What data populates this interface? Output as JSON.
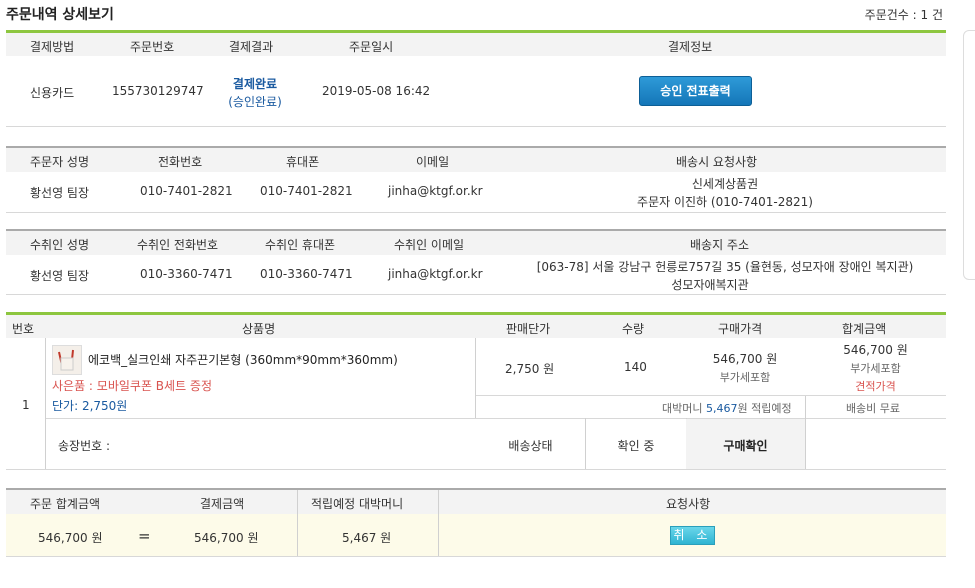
{
  "page": {
    "title": "주문내역 상세보기",
    "order_count": "주문건수 : 1 건"
  },
  "payment": {
    "headers": [
      "결제방법",
      "주문번호",
      "결제결과",
      "주문일시",
      "결제정보"
    ],
    "method": "신용카드",
    "order_no": "155730129747",
    "result": "결제완료",
    "result_sub": "(승인완료)",
    "date": "2019-05-08 16:42",
    "print_button": "승인 전표출력"
  },
  "orderer": {
    "headers": [
      "주문자 성명",
      "전화번호",
      "휴대폰",
      "이메일",
      "배송시 요청사항"
    ],
    "name": "황선영 팀장",
    "phone": "010-7401-2821",
    "mobile": "010-7401-2821",
    "email": "jinha@ktgf.or.kr",
    "request_line1": "신세계상품권",
    "request_line2": "주문자 이진하 (010-7401-2821)"
  },
  "recipient": {
    "headers": [
      "수취인 성명",
      "수취인 전화번호",
      "수취인 휴대폰",
      "수취인 이메일",
      "배송지 주소"
    ],
    "name": "황선영 팀장",
    "phone": "010-3360-7471",
    "mobile": "010-3360-7471",
    "email": "jinha@ktgf.or.kr",
    "address_line1": "[063-78] 서울 강남구 헌릉로757길 35 (율현동, 성모자애 장애인 복지관)",
    "address_line2": "성모자애복지관"
  },
  "items": {
    "headers": [
      "번호",
      "상품명",
      "판매단가",
      "수량",
      "구매가격",
      "합계금액"
    ],
    "row": {
      "no": "1",
      "name": "에코백_실크인쇄 자주끈기본형",
      "size": "(360mm*90mm*360mm)",
      "gift": "사은품 : 모바일쿠폰 B세트 증정",
      "unit_price_label": "단가: 2,750원",
      "price": "2,750 원",
      "qty": "140",
      "purchase": "546,700 원",
      "purchase_note": "부가세포함",
      "total": "546,700 원",
      "total_note": "부가세포함",
      "quote": "견적가격",
      "points_prefix": "대박머니",
      "points_value": "5,467",
      "points_suffix": "원 적립예정",
      "shipping_fee": "배송비 무료",
      "tracking_label": "송장번호 :",
      "ship_status": "배송상태",
      "checking": "확인 중",
      "confirm": "구매확인"
    }
  },
  "totals": {
    "headers": [
      "주문 합계금액",
      "결제금액",
      "적립예정 대박머니",
      "요청사항"
    ],
    "order_total": "546,700 원",
    "equals": "=",
    "paid": "546,700 원",
    "points": "5,467 원",
    "cancel_button": "취 소"
  }
}
